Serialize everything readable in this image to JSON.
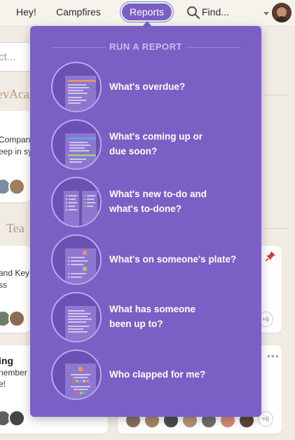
{
  "nav": {
    "hey_label": "Hey!",
    "campfires_label": "Campfires",
    "reports_label": "Reports",
    "find_label": "Find...",
    "accent": "#7b5fc4"
  },
  "background": {
    "search_placeholder": "ct...",
    "heading_1": "evAca",
    "card_1_line_1": "Compan",
    "card_1_line_2": "eep in sy",
    "heading_2": "Tea",
    "card_2_line_1": "and Key",
    "card_2_line_2": "ss",
    "card_3_title": "ing",
    "card_3_line_1": "nember",
    "card_3_line_2": "e!",
    "plus_count_1": "+6",
    "plus_count_2": "+6"
  },
  "reports_menu": {
    "heading": "RUN A REPORT",
    "items": [
      {
        "line1": "What's overdue?",
        "line2": "",
        "icon": "overdue-report-icon"
      },
      {
        "line1": "What's coming up or",
        "line2": "due soon?",
        "icon": "upcoming-report-icon"
      },
      {
        "line1": "What's new to-do and",
        "line2": "what's to-done?",
        "icon": "todo-report-icon"
      },
      {
        "line1": "What's on someone's plate?",
        "line2": "",
        "icon": "assignments-report-icon"
      },
      {
        "line1": "What has someone",
        "line2": "been up to?",
        "icon": "activity-report-icon"
      },
      {
        "line1": "Who clapped for me?",
        "line2": "",
        "icon": "boosts-report-icon"
      }
    ]
  }
}
